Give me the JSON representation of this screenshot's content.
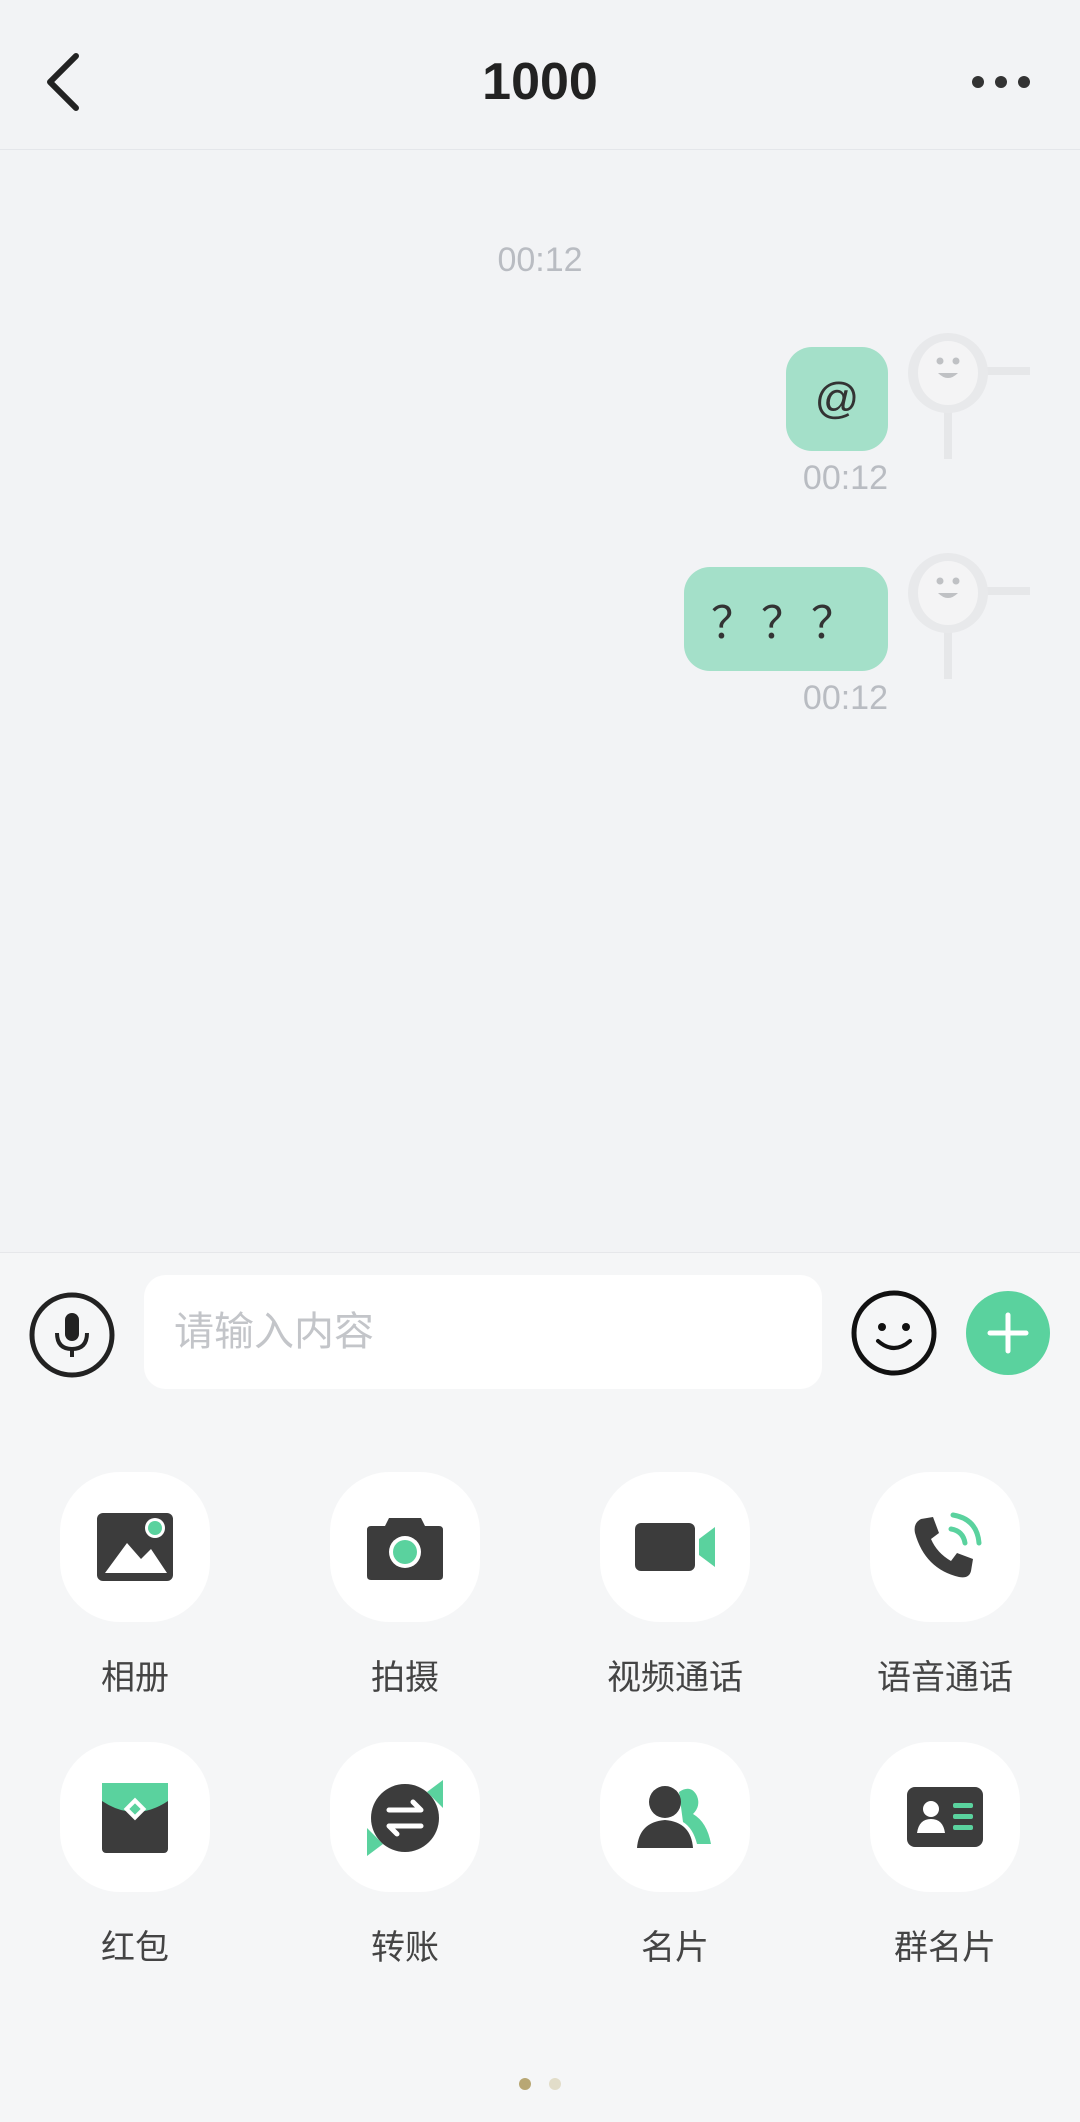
{
  "header": {
    "title": "1000",
    "back_icon": "chevron-left-icon",
    "more_icon": "more-horizontal-icon"
  },
  "chat": {
    "center_time": "00:12",
    "messages": [
      {
        "text": "@",
        "time": "00:12",
        "sender": "self"
      },
      {
        "text": "？？？",
        "time": "00:12",
        "sender": "self"
      }
    ],
    "bubble_color": "#a4e0c9"
  },
  "input": {
    "placeholder": "请输入内容",
    "value": "",
    "mic_icon": "microphone-icon",
    "emoji_icon": "smile-icon",
    "plus_icon": "plus-icon",
    "accent_color": "#5ad29e"
  },
  "tools": [
    {
      "label": "相册",
      "icon": "album-icon"
    },
    {
      "label": "拍摄",
      "icon": "camera-icon"
    },
    {
      "label": "视频通话",
      "icon": "video-call-icon"
    },
    {
      "label": "语音通话",
      "icon": "voice-call-icon"
    },
    {
      "label": "红包",
      "icon": "red-packet-icon"
    },
    {
      "label": "转账",
      "icon": "transfer-icon"
    },
    {
      "label": "名片",
      "icon": "contact-card-icon"
    },
    {
      "label": "群名片",
      "icon": "group-card-icon"
    }
  ],
  "pager": {
    "pages": 2,
    "current": 1
  }
}
